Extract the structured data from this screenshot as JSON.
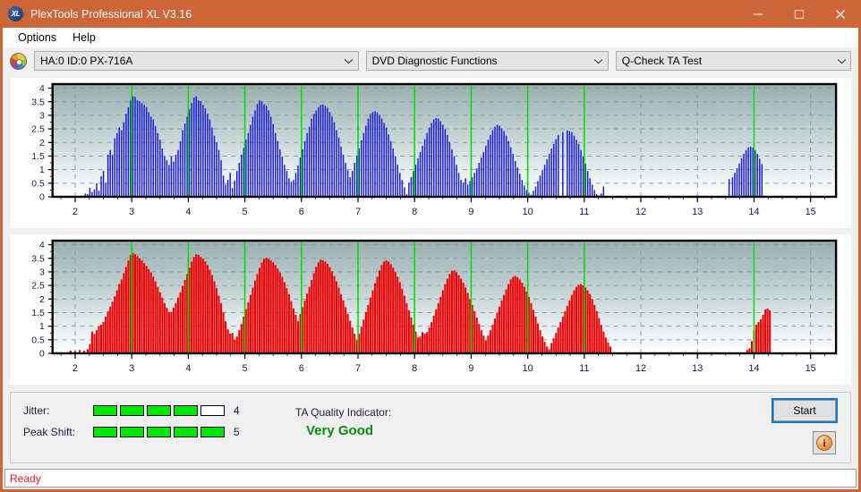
{
  "window": {
    "title": "PlexTools Professional XL V3.16",
    "app_icon": "xl-logo-icon",
    "minimize_label": "minimize-icon",
    "maximize_label": "maximize-icon",
    "close_label": "close-icon",
    "titlebar_color": "#cd6539"
  },
  "menu": {
    "items": [
      {
        "label": "Options"
      },
      {
        "label": "Help"
      }
    ]
  },
  "selectors": {
    "drive_icon": "disc-icon",
    "drive": {
      "value": "HA:0 ID:0  PX-716A"
    },
    "function": {
      "value": "DVD Diagnostic Functions"
    },
    "test": {
      "value": "Q-Check TA Test"
    }
  },
  "metrics": {
    "jitter": {
      "label": "Jitter:",
      "value": "4",
      "filled": 4,
      "total": 5
    },
    "peak_shift": {
      "label": "Peak Shift:",
      "value": "5",
      "filled": 5,
      "total": 5
    },
    "quality": {
      "label": "TA Quality Indicator:",
      "value": "Very Good",
      "color": "#0a8f0a"
    }
  },
  "actions": {
    "start": {
      "label": "Start"
    },
    "info": {
      "label": "i",
      "icon": "info-icon"
    }
  },
  "status": {
    "text": "Ready"
  },
  "chart_data": [
    {
      "id": "jitter-chart",
      "type": "bar",
      "title": "",
      "xlabel": "",
      "ylabel": "",
      "color": "#1a1ad8",
      "xlim": [
        1.6,
        15.45
      ],
      "ylim": [
        0,
        4.15
      ],
      "yticks": [
        0,
        0.5,
        1,
        1.5,
        2,
        2.5,
        3,
        3.5,
        4
      ],
      "ytick_labels": [
        "0",
        "0.5",
        "1",
        "1.5",
        "2",
        "2.5",
        "3",
        "3.5",
        "4"
      ],
      "xticks": [
        2,
        3,
        4,
        5,
        6,
        7,
        8,
        9,
        10,
        11,
        12,
        13,
        14,
        15
      ],
      "xtick_labels": [
        "2",
        "3",
        "4",
        "5",
        "6",
        "7",
        "8",
        "9",
        "10",
        "11",
        "12",
        "13",
        "14",
        "15"
      ],
      "grid": true,
      "marker_lines": [
        3,
        4,
        5,
        6,
        7,
        8,
        9,
        10,
        11,
        14
      ],
      "marker_color": "#00e000",
      "bar_gap_ratio": 0.42,
      "x": [
        2.1,
        2.14,
        2.18,
        2.22,
        2.26,
        2.3,
        2.34,
        2.38,
        2.42,
        2.46,
        2.5,
        2.54,
        2.58,
        2.62,
        2.66,
        2.7,
        2.74,
        2.78,
        2.82,
        2.86,
        2.9,
        2.94,
        2.98,
        3.02,
        3.06,
        3.1,
        3.14,
        3.18,
        3.22,
        3.26,
        3.3,
        3.34,
        3.38,
        3.42,
        3.46,
        3.5,
        3.54,
        3.58,
        3.62,
        3.66,
        3.7,
        3.74,
        3.78,
        3.82,
        3.86,
        3.9,
        3.94,
        3.98,
        4.02,
        4.06,
        4.1,
        4.14,
        4.18,
        4.22,
        4.26,
        4.3,
        4.34,
        4.38,
        4.42,
        4.46,
        4.5,
        4.54,
        4.58,
        4.62,
        4.66,
        4.7,
        4.74,
        4.78,
        4.82,
        4.86,
        4.9,
        4.94,
        4.98,
        5.02,
        5.06,
        5.1,
        5.14,
        5.18,
        5.22,
        5.26,
        5.3,
        5.34,
        5.38,
        5.42,
        5.46,
        5.5,
        5.54,
        5.58,
        5.62,
        5.66,
        5.7,
        5.74,
        5.78,
        5.82,
        5.86,
        5.9,
        5.94,
        5.98,
        6.02,
        6.06,
        6.1,
        6.14,
        6.18,
        6.22,
        6.26,
        6.3,
        6.34,
        6.38,
        6.42,
        6.46,
        6.5,
        6.54,
        6.58,
        6.62,
        6.66,
        6.7,
        6.74,
        6.78,
        6.82,
        6.86,
        6.9,
        6.94,
        6.98,
        7.02,
        7.06,
        7.1,
        7.14,
        7.18,
        7.22,
        7.26,
        7.3,
        7.34,
        7.38,
        7.42,
        7.46,
        7.5,
        7.54,
        7.58,
        7.62,
        7.66,
        7.7,
        7.74,
        7.78,
        7.82,
        7.86,
        7.9,
        7.94,
        7.98,
        8.02,
        8.06,
        8.1,
        8.14,
        8.18,
        8.22,
        8.26,
        8.3,
        8.34,
        8.38,
        8.42,
        8.46,
        8.5,
        8.54,
        8.58,
        8.62,
        8.66,
        8.7,
        8.74,
        8.78,
        8.82,
        8.86,
        8.9,
        8.94,
        8.98,
        9.02,
        9.06,
        9.1,
        9.14,
        9.18,
        9.22,
        9.26,
        9.3,
        9.34,
        9.38,
        9.42,
        9.46,
        9.5,
        9.54,
        9.58,
        9.62,
        9.66,
        9.7,
        9.74,
        9.78,
        9.82,
        9.86,
        9.9,
        9.94,
        9.98,
        10.02,
        10.06,
        10.1,
        10.14,
        10.18,
        10.22,
        10.26,
        10.3,
        10.34,
        10.38,
        10.42,
        10.46,
        10.5,
        10.54,
        10.62,
        10.7,
        10.74,
        10.78,
        10.82,
        10.86,
        10.9,
        10.94,
        10.98,
        11.02,
        11.06,
        11.1,
        11.14,
        11.18,
        11.22,
        11.26,
        11.3,
        11.34,
        13.56,
        13.62,
        13.66,
        13.7,
        13.74,
        13.78,
        13.82,
        13.86,
        13.9,
        13.94,
        13.98,
        14.02,
        14.06,
        14.1,
        14.14
      ],
      "values": [
        0.05,
        0.02,
        0.12,
        0.1,
        0.33,
        0.18,
        0.28,
        0.5,
        0.22,
        0.75,
        0.95,
        0.52,
        1.55,
        1.72,
        1.55,
        2.15,
        2.35,
        2.55,
        2.45,
        2.75,
        3.05,
        3.3,
        3.55,
        3.7,
        3.68,
        3.55,
        3.52,
        3.45,
        3.38,
        3.3,
        3.12,
        2.95,
        2.85,
        2.6,
        2.35,
        2.1,
        1.78,
        1.5,
        1.35,
        1.18,
        1.48,
        1.3,
        1.55,
        1.72,
        2.05,
        2.45,
        2.7,
        2.95,
        3.22,
        3.45,
        3.65,
        3.7,
        3.55,
        3.52,
        3.38,
        3.25,
        3.05,
        2.85,
        2.55,
        2.25,
        2.0,
        1.72,
        1.35,
        0.78,
        0.45,
        0.62,
        0.88,
        0.32,
        0.6,
        0.95,
        1.25,
        1.55,
        1.8,
        2.1,
        2.35,
        2.65,
        2.95,
        3.18,
        3.42,
        3.55,
        3.52,
        3.4,
        3.35,
        3.18,
        2.95,
        2.68,
        2.35,
        2.05,
        1.75,
        1.48,
        1.18,
        0.95,
        0.68,
        0.55,
        0.62,
        0.88,
        1.15,
        1.45,
        1.75,
        2.05,
        2.35,
        2.58,
        2.88,
        3.05,
        3.18,
        3.3,
        3.38,
        3.4,
        3.35,
        3.28,
        3.12,
        2.95,
        2.75,
        2.45,
        2.18,
        1.85,
        1.55,
        1.25,
        0.98,
        0.72,
        0.95,
        1.25,
        1.52,
        1.78,
        2.08,
        2.35,
        2.62,
        2.88,
        3.05,
        3.12,
        3.15,
        3.1,
        3.02,
        2.88,
        2.72,
        2.55,
        2.3,
        2.05,
        1.78,
        1.48,
        1.18,
        0.88,
        0.62,
        0.35,
        0.1,
        0.52,
        0.72,
        0.95,
        1.18,
        1.42,
        1.65,
        1.88,
        2.12,
        2.35,
        2.55,
        2.72,
        2.85,
        2.9,
        2.88,
        2.78,
        2.65,
        2.48,
        2.28,
        2.02,
        1.75,
        1.48,
        1.18,
        0.88,
        0.62,
        0.52,
        0.68,
        0.45,
        0.58,
        0.72,
        0.88,
        1.05,
        1.25,
        1.45,
        1.65,
        1.88,
        2.1,
        2.28,
        2.45,
        2.58,
        2.65,
        2.62,
        2.52,
        2.42,
        2.25,
        2.05,
        1.82,
        1.58,
        1.32,
        1.08,
        0.85,
        0.62,
        0.42,
        0.25,
        0.15,
        0.08,
        0.22,
        0.38,
        0.58,
        0.78,
        0.98,
        1.18,
        1.38,
        1.58,
        1.78,
        1.95,
        2.12,
        2.28,
        2.38,
        2.45,
        2.42,
        2.38,
        2.25,
        2.1,
        1.95,
        1.72,
        1.48,
        1.22,
        0.95,
        0.68,
        0.45,
        0.25,
        0.1,
        0.05,
        0.12,
        0.38,
        0.65,
        0.72,
        0.88,
        1.05,
        1.22,
        1.42,
        1.58,
        1.72,
        1.82,
        1.85,
        1.8,
        1.72,
        1.58,
        1.4,
        1.2,
        0.95,
        0.65,
        0.4,
        0.15,
        0.55,
        0.22,
        0.45,
        0.68,
        0.92,
        1.15,
        1.38,
        1.62,
        1.88,
        2.05,
        2.18,
        2.22,
        2.15,
        1.98,
        1.72,
        1.45
      ]
    },
    {
      "id": "peak-shift-chart",
      "type": "bar",
      "title": "",
      "xlabel": "",
      "ylabel": "",
      "color": "#ef0000",
      "xlim": [
        1.6,
        15.45
      ],
      "ylim": [
        0,
        4.15
      ],
      "yticks": [
        0,
        0.5,
        1,
        1.5,
        2,
        2.5,
        3,
        3.5,
        4
      ],
      "ytick_labels": [
        "0",
        "0.5",
        "1",
        "1.5",
        "2",
        "2.5",
        "3",
        "3.5",
        "4"
      ],
      "xticks": [
        2,
        3,
        4,
        5,
        6,
        7,
        8,
        9,
        10,
        11,
        12,
        13,
        14,
        15
      ],
      "xtick_labels": [
        "2",
        "3",
        "4",
        "5",
        "6",
        "7",
        "8",
        "9",
        "10",
        "11",
        "12",
        "13",
        "14",
        "15"
      ],
      "grid": true,
      "marker_lines": [
        3,
        4,
        5,
        6,
        7,
        8,
        9,
        10,
        11,
        14
      ],
      "marker_color": "#00e000",
      "bar_gap_ratio": 0.18,
      "x": [
        1.92,
        2.0,
        2.08,
        2.16,
        2.22,
        2.26,
        2.3,
        2.34,
        2.38,
        2.42,
        2.46,
        2.5,
        2.54,
        2.58,
        2.62,
        2.66,
        2.7,
        2.74,
        2.78,
        2.82,
        2.86,
        2.9,
        2.94,
        2.98,
        3.02,
        3.06,
        3.1,
        3.14,
        3.18,
        3.22,
        3.26,
        3.3,
        3.34,
        3.38,
        3.42,
        3.46,
        3.5,
        3.54,
        3.58,
        3.62,
        3.66,
        3.7,
        3.74,
        3.78,
        3.82,
        3.86,
        3.9,
        3.94,
        3.98,
        4.02,
        4.06,
        4.1,
        4.14,
        4.18,
        4.22,
        4.26,
        4.3,
        4.34,
        4.38,
        4.42,
        4.46,
        4.5,
        4.54,
        4.58,
        4.62,
        4.66,
        4.7,
        4.74,
        4.78,
        4.82,
        4.86,
        4.9,
        4.94,
        4.98,
        5.02,
        5.06,
        5.1,
        5.14,
        5.18,
        5.22,
        5.26,
        5.3,
        5.34,
        5.38,
        5.42,
        5.46,
        5.5,
        5.54,
        5.58,
        5.62,
        5.66,
        5.7,
        5.74,
        5.78,
        5.82,
        5.86,
        5.9,
        5.94,
        5.98,
        6.02,
        6.06,
        6.1,
        6.14,
        6.18,
        6.22,
        6.26,
        6.3,
        6.34,
        6.38,
        6.42,
        6.46,
        6.5,
        6.54,
        6.58,
        6.62,
        6.66,
        6.7,
        6.74,
        6.78,
        6.82,
        6.86,
        6.9,
        6.94,
        6.98,
        7.02,
        7.06,
        7.1,
        7.14,
        7.18,
        7.22,
        7.26,
        7.3,
        7.34,
        7.38,
        7.42,
        7.46,
        7.5,
        7.54,
        7.58,
        7.62,
        7.66,
        7.7,
        7.74,
        7.78,
        7.82,
        7.86,
        7.9,
        7.94,
        7.98,
        8.02,
        8.06,
        8.1,
        8.14,
        8.18,
        8.22,
        8.26,
        8.3,
        8.34,
        8.38,
        8.42,
        8.46,
        8.5,
        8.54,
        8.58,
        8.62,
        8.66,
        8.7,
        8.74,
        8.78,
        8.82,
        8.86,
        8.9,
        8.94,
        8.98,
        9.02,
        9.06,
        9.1,
        9.14,
        9.18,
        9.22,
        9.26,
        9.3,
        9.34,
        9.38,
        9.42,
        9.46,
        9.5,
        9.54,
        9.58,
        9.62,
        9.66,
        9.7,
        9.74,
        9.78,
        9.82,
        9.86,
        9.9,
        9.94,
        9.98,
        10.02,
        10.06,
        10.1,
        10.14,
        10.18,
        10.22,
        10.26,
        10.3,
        10.34,
        10.38,
        10.42,
        10.46,
        10.5,
        10.54,
        10.58,
        10.62,
        10.66,
        10.7,
        10.74,
        10.78,
        10.82,
        10.86,
        10.9,
        10.94,
        10.98,
        11.02,
        11.06,
        11.1,
        11.14,
        11.18,
        11.22,
        11.26,
        11.3,
        11.34,
        11.38,
        11.42,
        11.46,
        13.88,
        13.92,
        13.96,
        14.0,
        14.04,
        14.08,
        14.12,
        14.16,
        14.2,
        14.24,
        14.28
      ],
      "values": [
        0.1,
        0.08,
        0.12,
        0.1,
        0.15,
        0.35,
        0.8,
        0.72,
        0.85,
        1.0,
        1.05,
        1.15,
        1.35,
        1.55,
        1.72,
        1.9,
        2.1,
        2.32,
        2.55,
        2.72,
        2.95,
        3.18,
        3.42,
        3.62,
        3.7,
        3.65,
        3.58,
        3.5,
        3.42,
        3.32,
        3.22,
        3.1,
        2.98,
        2.82,
        2.65,
        2.45,
        2.25,
        2.05,
        1.85,
        1.68,
        1.52,
        1.52,
        1.68,
        1.85,
        2.05,
        2.25,
        2.48,
        2.7,
        2.92,
        3.15,
        3.38,
        3.55,
        3.65,
        3.62,
        3.55,
        3.48,
        3.38,
        3.25,
        3.08,
        2.88,
        2.65,
        2.4,
        2.12,
        1.85,
        1.52,
        1.18,
        0.88,
        0.72,
        0.75,
        0.5,
        0.62,
        0.85,
        1.08,
        1.35,
        1.62,
        1.88,
        2.15,
        2.42,
        2.68,
        2.92,
        3.15,
        3.35,
        3.48,
        3.52,
        3.48,
        3.42,
        3.35,
        3.25,
        3.12,
        2.98,
        2.82,
        2.62,
        2.4,
        2.18,
        1.92,
        1.65,
        1.42,
        1.18,
        1.45,
        1.7,
        1.95,
        2.2,
        2.45,
        2.7,
        2.95,
        3.18,
        3.35,
        3.45,
        3.42,
        3.38,
        3.3,
        3.18,
        3.02,
        2.85,
        2.65,
        2.42,
        2.18,
        1.95,
        1.7,
        1.45,
        1.2,
        0.95,
        0.72,
        0.48,
        0.72,
        0.98,
        1.25,
        1.52,
        1.78,
        2.05,
        2.32,
        2.58,
        2.82,
        3.05,
        3.25,
        3.38,
        3.42,
        3.38,
        3.28,
        3.15,
        3.0,
        2.82,
        2.62,
        2.38,
        2.12,
        1.85,
        1.58,
        1.32,
        1.05,
        0.8,
        0.58,
        0.62,
        0.78,
        0.72,
        0.78,
        0.95,
        1.15,
        1.38,
        1.62,
        1.85,
        2.08,
        2.32,
        2.55,
        2.75,
        2.92,
        3.05,
        3.05,
        2.98,
        2.88,
        2.75,
        2.6,
        2.42,
        2.22,
        2.0,
        1.78,
        1.55,
        1.32,
        1.08,
        0.85,
        0.65,
        0.48,
        0.65,
        0.85,
        1.05,
        1.28,
        1.5,
        1.72,
        1.95,
        2.15,
        2.35,
        2.55,
        2.72,
        2.82,
        2.85,
        2.8,
        2.72,
        2.6,
        2.45,
        2.28,
        2.08,
        1.85,
        1.6,
        1.35,
        1.1,
        0.85,
        0.62,
        0.42,
        0.25,
        0.15,
        0.38,
        0.55,
        0.75,
        0.95,
        1.15,
        1.35,
        1.55,
        1.75,
        1.95,
        2.15,
        2.32,
        2.45,
        2.52,
        2.55,
        2.5,
        2.42,
        2.32,
        2.18,
        2.0,
        1.78,
        1.55,
        1.3,
        1.05,
        0.8,
        0.58,
        0.4,
        0.25,
        0.12,
        0.18,
        0.45,
        0.85,
        1.05,
        1.15,
        1.25,
        1.42,
        1.62,
        1.65,
        1.58,
        1.52,
        1.45,
        1.35,
        1.22,
        1.08,
        0.92,
        0.78,
        0.62,
        0.48,
        0.32,
        0.18,
        0.15,
        0.12,
        0.2,
        0.12,
        0.18,
        0.45,
        0.85,
        1.05,
        1.18,
        1.22,
        1.05,
        0.82,
        0.58,
        0.32,
        0.18,
        0.65
      ]
    }
  ]
}
